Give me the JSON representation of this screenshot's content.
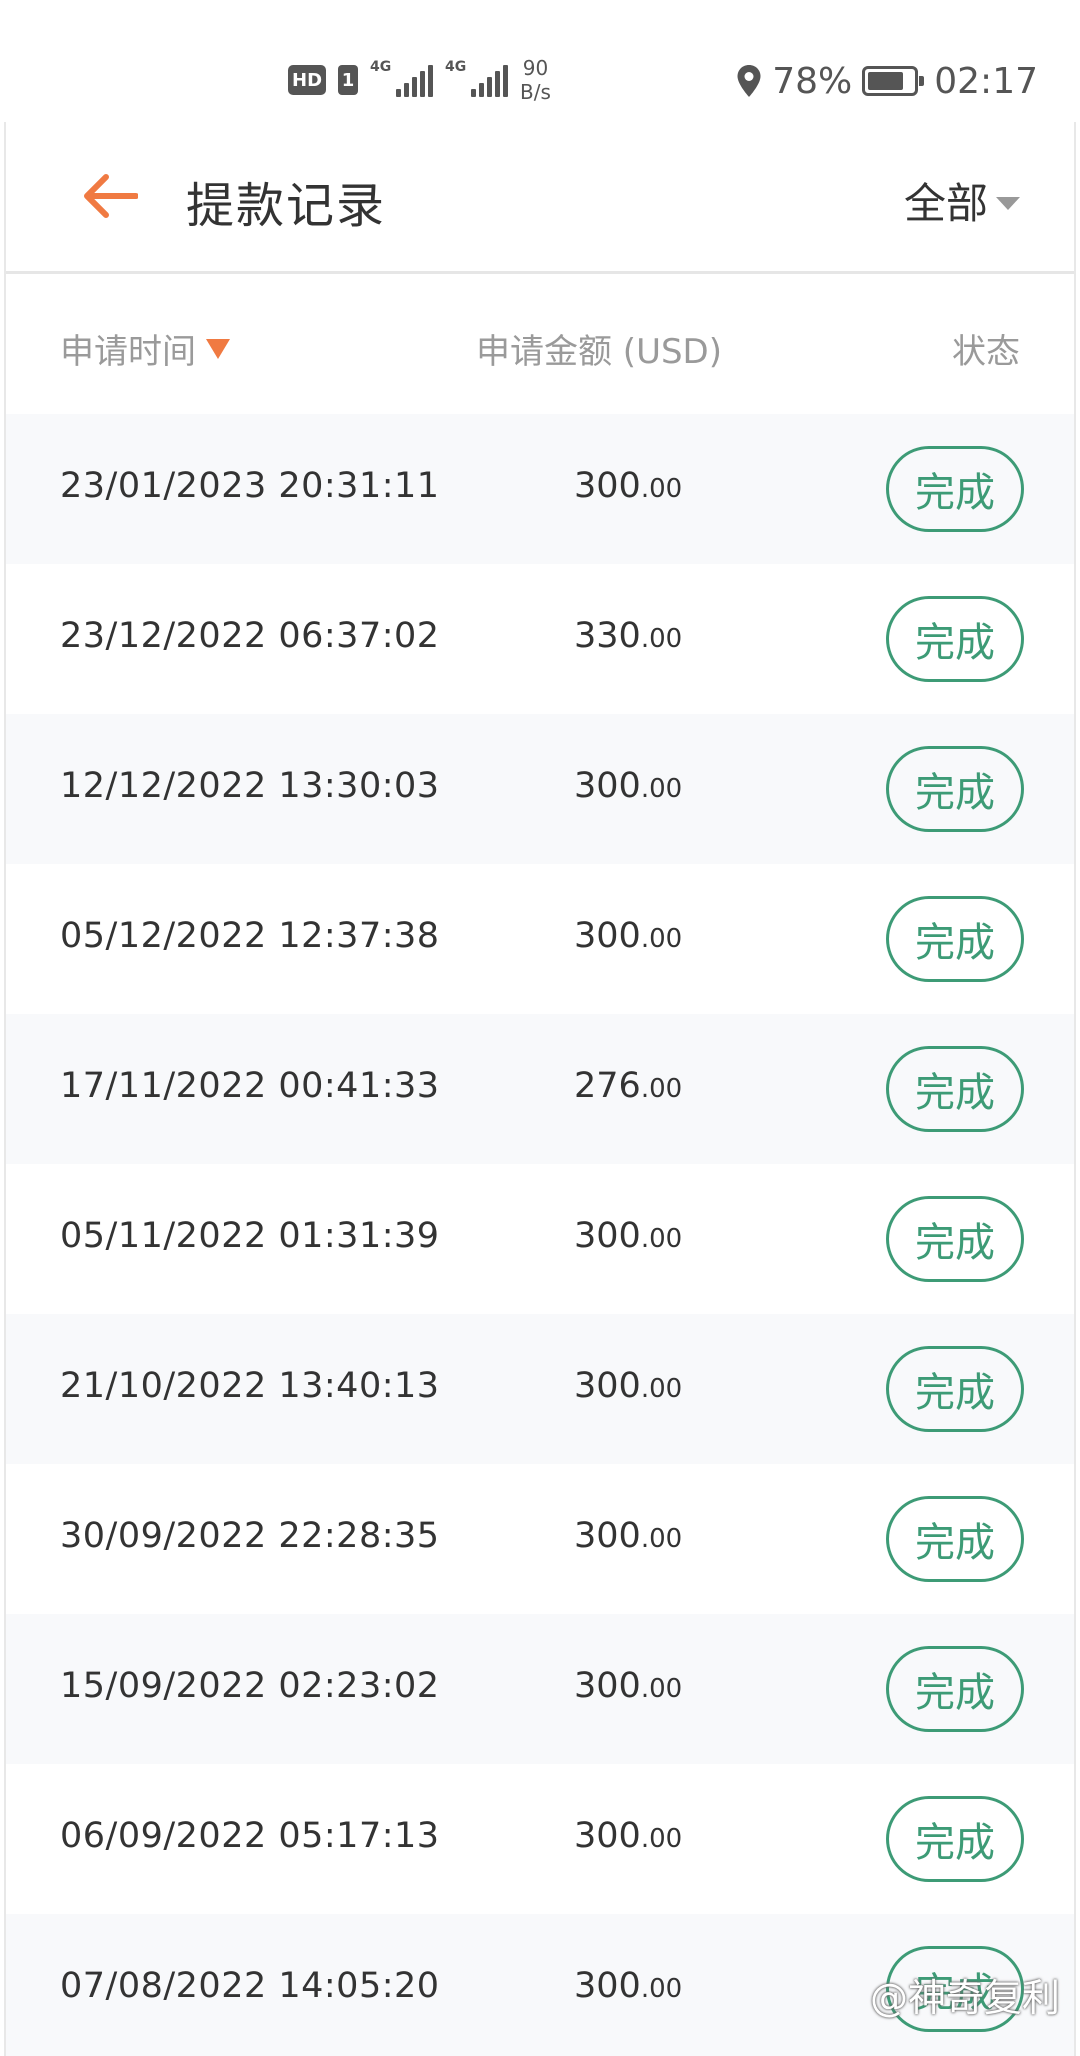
{
  "status_bar": {
    "hd_label": "HD",
    "sim_label": "1",
    "network_1": "4G",
    "network_2": "4G",
    "speed_value": "90",
    "speed_unit": "B/s",
    "battery_percent": "78%",
    "battery_level": 0.78,
    "time": "02:17"
  },
  "header": {
    "title": "提款记录",
    "filter_label": "全部"
  },
  "table": {
    "columns": {
      "time": "申请时间",
      "amount": "申请金额 (USD)",
      "status": "状态"
    },
    "rows": [
      {
        "time": "23/01/2023 20:31:11",
        "amount_int": "300",
        "amount_dec": ".00",
        "status": "完成"
      },
      {
        "time": "23/12/2022 06:37:02",
        "amount_int": "330",
        "amount_dec": ".00",
        "status": "完成"
      },
      {
        "time": "12/12/2022 13:30:03",
        "amount_int": "300",
        "amount_dec": ".00",
        "status": "完成"
      },
      {
        "time": "05/12/2022 12:37:38",
        "amount_int": "300",
        "amount_dec": ".00",
        "status": "完成"
      },
      {
        "time": "17/11/2022 00:41:33",
        "amount_int": "276",
        "amount_dec": ".00",
        "status": "完成"
      },
      {
        "time": "05/11/2022 01:31:39",
        "amount_int": "300",
        "amount_dec": ".00",
        "status": "完成"
      },
      {
        "time": "21/10/2022 13:40:13",
        "amount_int": "300",
        "amount_dec": ".00",
        "status": "完成"
      },
      {
        "time": "30/09/2022 22:28:35",
        "amount_int": "300",
        "amount_dec": ".00",
        "status": "完成"
      },
      {
        "time": "15/09/2022 02:23:02",
        "amount_int": "300",
        "amount_dec": ".00",
        "status": "完成"
      },
      {
        "time": "06/09/2022 05:17:13",
        "amount_int": "300",
        "amount_dec": ".00",
        "status": "完成"
      },
      {
        "time": "07/08/2022 14:05:20",
        "amount_int": "300",
        "amount_dec": ".00",
        "status": "完成"
      }
    ]
  },
  "watermark": {
    "text": "@神奇复利"
  },
  "colors": {
    "accent_orange": "#f07a42",
    "status_green": "#3d9b76",
    "header_text": "#9a9a9a",
    "row_alt": "#f8f9fb"
  }
}
